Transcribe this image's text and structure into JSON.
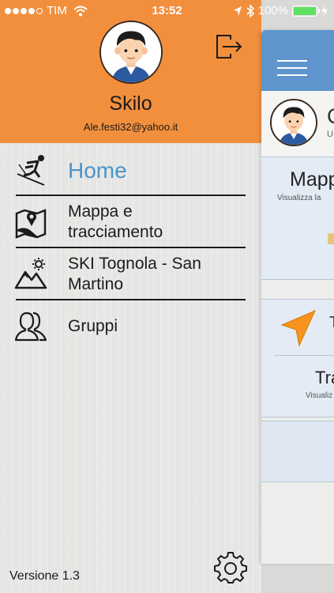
{
  "status_bar": {
    "carrier": "TIM",
    "time": "13:52",
    "battery_text": "100%",
    "battery_level": 1.0
  },
  "drawer": {
    "header_color": "#f28f3d",
    "profile": {
      "name": "Skilo",
      "email": "Ale.festi32@yahoo.it"
    },
    "menu": [
      {
        "label": "Home",
        "icon": "skier-icon",
        "active": true
      },
      {
        "label": "Mappa e\ntracciamento",
        "icon": "map-pin-icon"
      },
      {
        "label": "SKI Tognola - San\nMartino",
        "icon": "mountain-icon"
      },
      {
        "label": "Gruppi",
        "icon": "group-icon"
      }
    ],
    "version": "Versione 1.3"
  },
  "main_peek": {
    "navbar_color": "#5d95cc",
    "profile_initial": "C",
    "profile_sub_initial": "U",
    "card_mappa": {
      "title": "Mapp",
      "subtitle": "Visualizza la"
    },
    "card_tracciamento": {
      "header_fragment": "T",
      "title": "Tra",
      "subtitle": "Visualiz"
    }
  },
  "colors": {
    "accent_blue": "#4b94c8",
    "nav_arrow": "#f7931e"
  }
}
